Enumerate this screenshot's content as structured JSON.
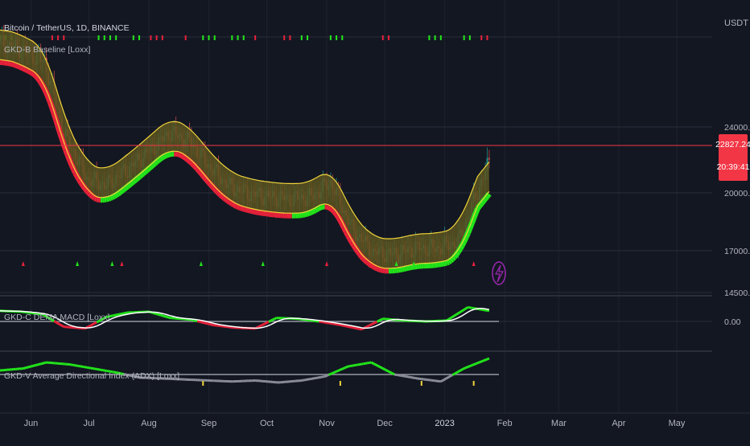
{
  "header": {
    "symbol_title": "Bitcoin / TetherUS, 1D, BINANCE",
    "baseline_label": "GKD-B Baseline [Loxx]",
    "currency": "USDT"
  },
  "colors": {
    "background": "#131722",
    "grid": "#2a2e39",
    "bull": "#22e61a",
    "bear": "#e8213a",
    "band": "#f0d43a",
    "band_fill": "#5a5320",
    "macd_signal": "#ffffff",
    "adx_weak": "#8c8f99",
    "price_line": "#f23645",
    "candle_up": "#26a69a",
    "candle_down": "#ef5350",
    "bolt": "#9c27b0"
  },
  "chart_data": [
    {
      "type": "line",
      "title": "Bitcoin / TetherUS, 1D, BINANCE",
      "ylabel": "USDT",
      "yscale": "log",
      "ylim": [
        14000,
        32000
      ],
      "grid": true,
      "x_ticks": [
        "Jun",
        "Jul",
        "Aug",
        "Sep",
        "Oct",
        "Nov",
        "Dec",
        "2023",
        "Feb",
        "Mar",
        "Apr",
        "May"
      ],
      "y_ticks": [
        24000.0,
        20000.0,
        17000.0,
        14500.0
      ],
      "last_price_label": "22827.24",
      "countdown_label": "20:39:41",
      "last_price": 22827.24,
      "series": [
        {
          "x": [
            "2022-05-16",
            "2022-05-26",
            "2022-06-08",
            "2022-06-18",
            "2022-06-30",
            "2022-07-10",
            "2022-07-22",
            "2022-08-02",
            "2022-08-12",
            "2022-08-22",
            "2022-09-01",
            "2022-09-12",
            "2022-09-22",
            "2022-10-03",
            "2022-10-14",
            "2022-10-24",
            "2022-11-03",
            "2022-11-14",
            "2022-11-25",
            "2022-12-06",
            "2022-12-17",
            "2022-12-28",
            "2023-01-08",
            "2023-01-18",
            "2023-01-24"
          ],
          "values": [
            31000,
            30500,
            29200,
            23500,
            20500,
            20100,
            21200,
            22400,
            23600,
            23000,
            21300,
            20000,
            19600,
            19400,
            19300,
            19400,
            20300,
            17600,
            16400,
            16300,
            16600,
            16600,
            16900,
            19700,
            21600
          ]
        }
      ]
    },
    {
      "type": "line",
      "title": "GKD-C DEMA MACD [Loxx]",
      "ylim": [
        -1,
        1
      ],
      "y_ticks": [
        0.0
      ],
      "series": [
        {
          "x": [
            "2022-05-16",
            "2022-05-27",
            "2022-06-07",
            "2022-06-18",
            "2022-06-29",
            "2022-07-10",
            "2022-07-21",
            "2022-08-01",
            "2022-08-12",
            "2022-08-23",
            "2022-09-03",
            "2022-09-14",
            "2022-09-25",
            "2022-10-06",
            "2022-10-17",
            "2022-10-28",
            "2022-11-08",
            "2022-11-19",
            "2022-11-30",
            "2022-12-11",
            "2022-12-22",
            "2023-01-02",
            "2023-01-13",
            "2023-01-24"
          ],
          "values": [
            0.6,
            0.55,
            0.4,
            -0.3,
            -0.4,
            0.25,
            0.5,
            0.55,
            0.2,
            0.1,
            -0.2,
            -0.35,
            -0.4,
            0.2,
            0.15,
            0.0,
            -0.2,
            -0.45,
            0.15,
            0.05,
            0.0,
            0.05,
            0.8,
            0.6
          ]
        }
      ]
    },
    {
      "type": "line",
      "title": "GKD-V Average Directional Index (ADX) [Loxx]",
      "series": [
        {
          "x": [
            "2022-05-16",
            "2022-05-28",
            "2022-06-09",
            "2022-06-21",
            "2022-07-03",
            "2022-07-15",
            "2022-07-27",
            "2022-08-08",
            "2022-08-20",
            "2022-09-01",
            "2022-09-13",
            "2022-09-25",
            "2022-10-07",
            "2022-10-19",
            "2022-10-31",
            "2022-11-12",
            "2022-11-24",
            "2022-12-06",
            "2022-12-18",
            "2022-12-30",
            "2023-01-11",
            "2023-01-24"
          ],
          "values": [
            0.2,
            0.3,
            0.6,
            0.5,
            0.3,
            0.1,
            -0.15,
            -0.2,
            -0.25,
            -0.3,
            -0.35,
            -0.3,
            -0.4,
            -0.3,
            -0.1,
            0.4,
            0.6,
            0.0,
            -0.2,
            -0.35,
            0.3,
            0.8
          ]
        }
      ]
    }
  ]
}
